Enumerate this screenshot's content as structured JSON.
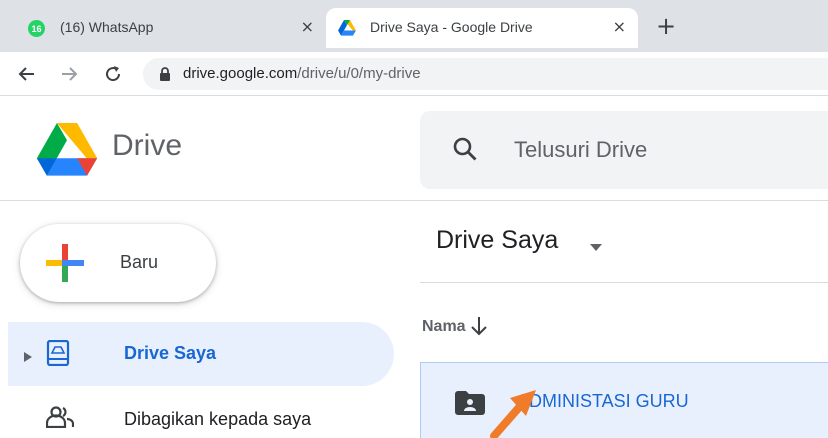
{
  "browser": {
    "tabs": [
      {
        "badge": "16",
        "title": "(16) WhatsApp",
        "close": "×"
      },
      {
        "title": "Drive Saya - Google Drive",
        "close": "×"
      }
    ],
    "new_tab": "+",
    "url_host": "drive.google.com",
    "url_path": "/drive/u/0/my-drive"
  },
  "drive": {
    "brand": "Drive",
    "search_placeholder": "Telusuri Drive",
    "new_button": "Baru",
    "nav": [
      {
        "label": "Drive Saya",
        "icon": "my-drive-icon"
      },
      {
        "label": "Dibagikan kepada saya",
        "icon": "shared-people-icon"
      }
    ],
    "page_title": "Drive Saya",
    "column_name": "Nama",
    "files": [
      {
        "name": "ADMINISTASI GURU",
        "icon": "shared-folder-icon"
      }
    ]
  },
  "colors": {
    "accent": "#1967d2",
    "selection": "#e8f0fe",
    "annotation_arrow": "#f07c2a",
    "whatsapp": "#25d366"
  }
}
